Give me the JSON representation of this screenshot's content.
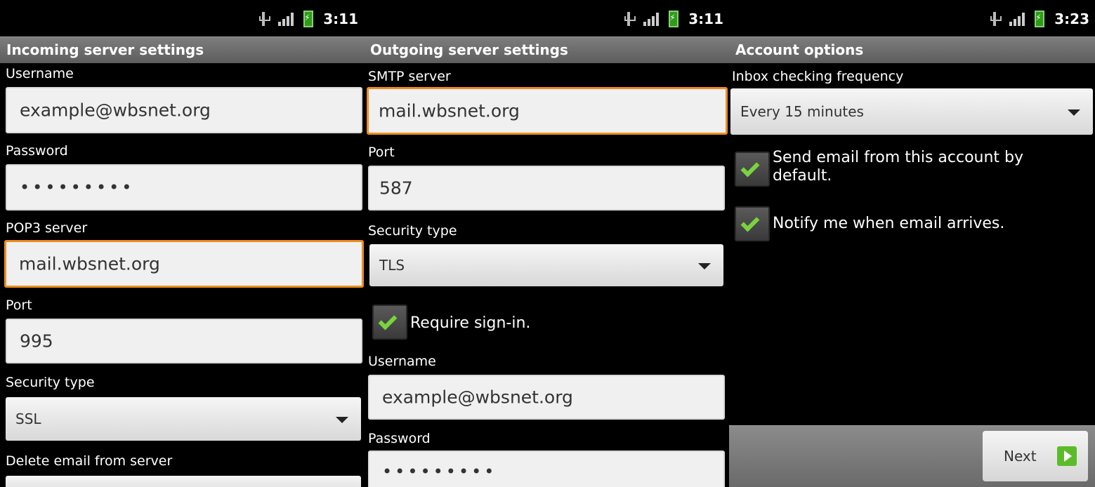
{
  "panels": [
    {
      "time": "3:11",
      "title": "Incoming server settings",
      "username_label": "Username",
      "username_value": "example@wbsnet.org",
      "password_label": "Password",
      "password_value": "•••••••••",
      "pop3_label": "POP3 server",
      "pop3_value": "mail.wbsnet.org",
      "port_label": "Port",
      "port_value": "995",
      "security_label": "Security type",
      "security_value": "SSL",
      "delete_label": "Delete email from server"
    },
    {
      "time": "3:11",
      "title": "Outgoing server settings",
      "smtp_label": "SMTP server",
      "smtp_value": "mail.wbsnet.org",
      "port_label": "Port",
      "port_value": "587",
      "security_label": "Security type",
      "security_value": "TLS",
      "require_signin_label": "Require sign-in.",
      "require_signin_checked": true,
      "username_label": "Username",
      "username_value": "example@wbsnet.org",
      "password_label": "Password",
      "password_value": "•••••••••"
    },
    {
      "time": "3:23",
      "title": "Account options",
      "frequency_label": "Inbox checking frequency",
      "frequency_value": "Every 15 minutes",
      "send_default_label": "Send email from this account by default.",
      "send_default_checked": true,
      "notify_label": "Notify me when email arrives.",
      "notify_checked": true,
      "next_label": "Next"
    }
  ],
  "colors": {
    "focus_border": "#ee8c1e",
    "checkmark": "#7bd33e",
    "battery": "#2e9c1a",
    "next_icon": "#5cbb2a"
  },
  "icons": [
    "usb-icon",
    "signal-icon",
    "battery-charging-icon",
    "chevron-down-icon",
    "checkmark-icon",
    "next-arrow-icon"
  ]
}
